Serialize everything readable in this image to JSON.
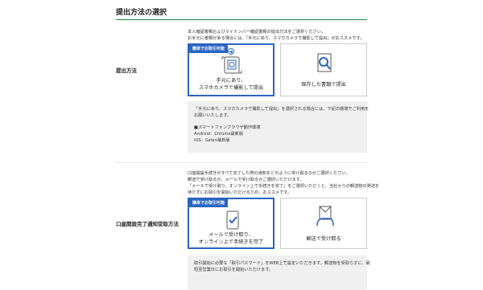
{
  "page": {
    "title": "提出方法の選択"
  },
  "submission": {
    "label": "提出方法",
    "desc": [
      "本人確認書類およびマイナンバー確認書類の提出方法をご選択ください。",
      "お手元に書類がある場合には、「手元にあり、スマホカメラで撮影して提出」がおススメです。"
    ],
    "options": [
      {
        "badge": "簡単でお取引可能",
        "line1": "手元にあり、",
        "line2": "スマホカメラで撮影して提出",
        "selected": true,
        "icon": "smartphone-camera-icon"
      },
      {
        "badge": "",
        "line1": "保存した書類で提出",
        "line2": "",
        "selected": false,
        "icon": "document-search-icon"
      }
    ],
    "note": {
      "intro": [
        "「手元にあり、スマホカメラで撮影して提出」を選択される場合には、下記の環境でご利用を",
        "お願いいたします。"
      ],
      "env_title": "■スマートフォンブラウザ動作環境",
      "env_items": [
        "Android：Chrome最新版",
        "iOS：Safari最新版"
      ]
    }
  },
  "notification": {
    "label": "口座開設完了通知受取方法",
    "desc": [
      "口座開設手続きがすべて完了した際の通知をどのように受け取るのかご選択ください。",
      "郵送で受け取るか、メールで受け取るかご選択いただけます。",
      "「メールで受け取り、オンライン上で手続きを完了」をご選択いただくと、当社からの郵送物の発送を",
      "待たずにお取引を開始いただけるため、おススメです。"
    ],
    "options": [
      {
        "badge": "簡単でお取引可能",
        "line1": "メールで受け取り、",
        "line2": "オンライン上で手続きを完了",
        "selected": true,
        "icon": "smartphone-check-icon"
      },
      {
        "badge": "",
        "line1": "郵送で受け取る",
        "line2": "",
        "selected": false,
        "icon": "mail-hand-icon"
      }
    ],
    "note": {
      "intro": [
        "取引開始に必要な「取引パスワード」をWEB上で設定いただきます。郵送物を受取らずに、最",
        "短翌営業日にお取引を開始いただけます。"
      ]
    }
  }
}
